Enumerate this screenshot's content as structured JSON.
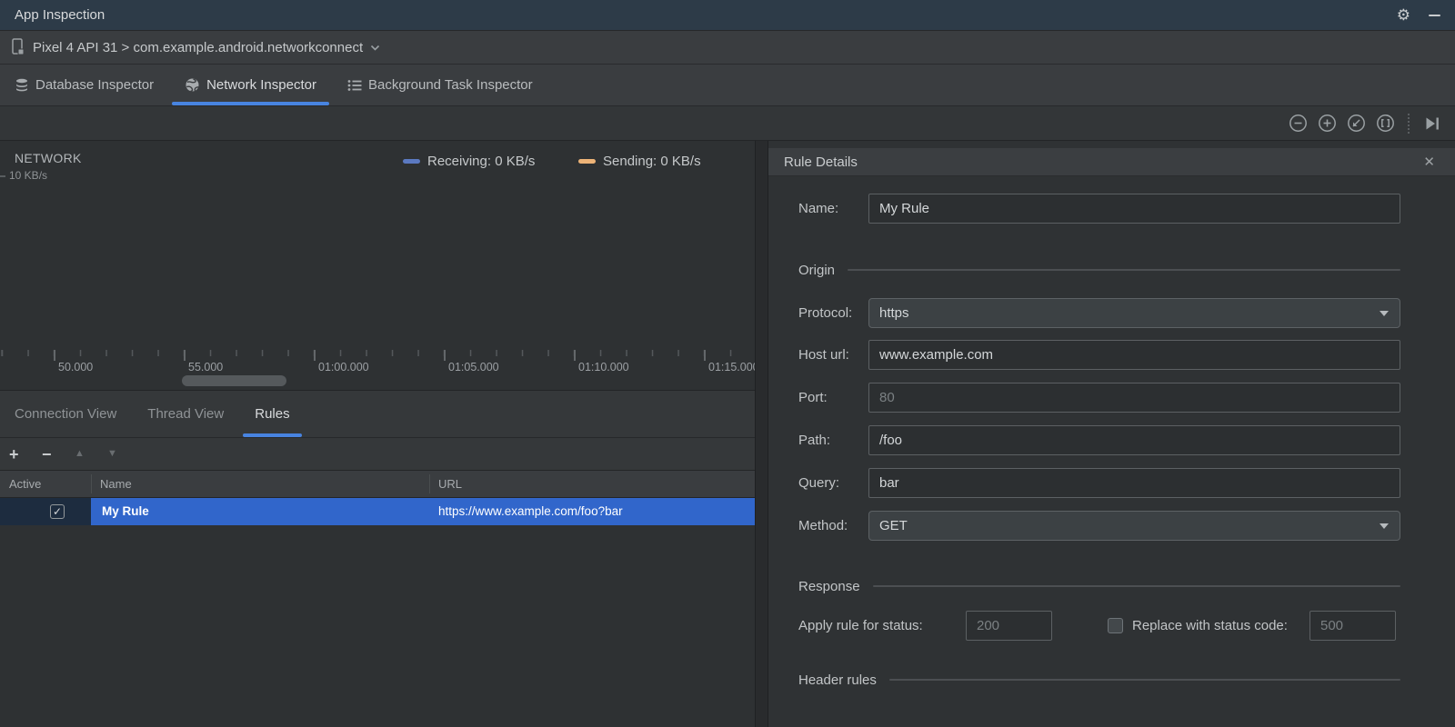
{
  "window": {
    "title": "App Inspection"
  },
  "icons": {
    "settings": "⚙",
    "close": "✕",
    "checkmark": "✓",
    "add": "+",
    "remove": "−",
    "move_up": "▲",
    "move_down": "▼"
  },
  "colors": {
    "titlebar": "#2d3b48",
    "accent_underline": "#4884e0",
    "selection_blue": "#3166cb",
    "active_cell_navy": "#1d2c3f",
    "receiving_swatch": "#5b79c1",
    "sending_swatch": "#edb377"
  },
  "device_bar": {
    "selector": "Pixel 4 API 31 > com.example.android.networkconnect"
  },
  "inspector_tabs": {
    "items": [
      {
        "label": "Database Inspector",
        "selected": false
      },
      {
        "label": "Network Inspector",
        "selected": true
      },
      {
        "label": "Background Task Inspector",
        "selected": false
      }
    ]
  },
  "chart": {
    "title": "NETWORK",
    "y_axis_label": "10 KB/s",
    "legend": {
      "receiving": {
        "label": "Receiving: 0 KB/s",
        "color": "#5b79c1"
      },
      "sending": {
        "label": "Sending: 0 KB/s",
        "color": "#edb377"
      }
    },
    "x_ticks": [
      "50.000",
      "55.000",
      "01:00.000",
      "01:05.000",
      "01:10.000",
      "01:15.000"
    ]
  },
  "view_tabs": {
    "items": [
      {
        "label": "Connection View",
        "selected": false
      },
      {
        "label": "Thread View",
        "selected": false
      },
      {
        "label": "Rules",
        "selected": true
      }
    ]
  },
  "rules_table": {
    "columns": [
      "Active",
      "Name",
      "URL"
    ],
    "rows": [
      {
        "active": true,
        "name": "My Rule",
        "url": "https://www.example.com/foo?bar",
        "selected": true
      }
    ]
  },
  "rule_details": {
    "title": "Rule Details",
    "sections": {
      "origin": "Origin",
      "response": "Response",
      "header_rules": "Header rules"
    },
    "fields": {
      "name": {
        "label": "Name:",
        "value": "My Rule"
      },
      "protocol": {
        "label": "Protocol:",
        "value": "https"
      },
      "host": {
        "label": "Host url:",
        "value": "www.example.com"
      },
      "port": {
        "label": "Port:",
        "placeholder": "80"
      },
      "path": {
        "label": "Path:",
        "value": "/foo"
      },
      "query": {
        "label": "Query:",
        "value": "bar"
      },
      "method": {
        "label": "Method:",
        "value": "GET"
      }
    },
    "response": {
      "apply_label": "Apply rule for status:",
      "apply_placeholder": "200",
      "replace_label": "Replace with status code:",
      "replace_placeholder": "500",
      "replace_checked": false
    }
  }
}
